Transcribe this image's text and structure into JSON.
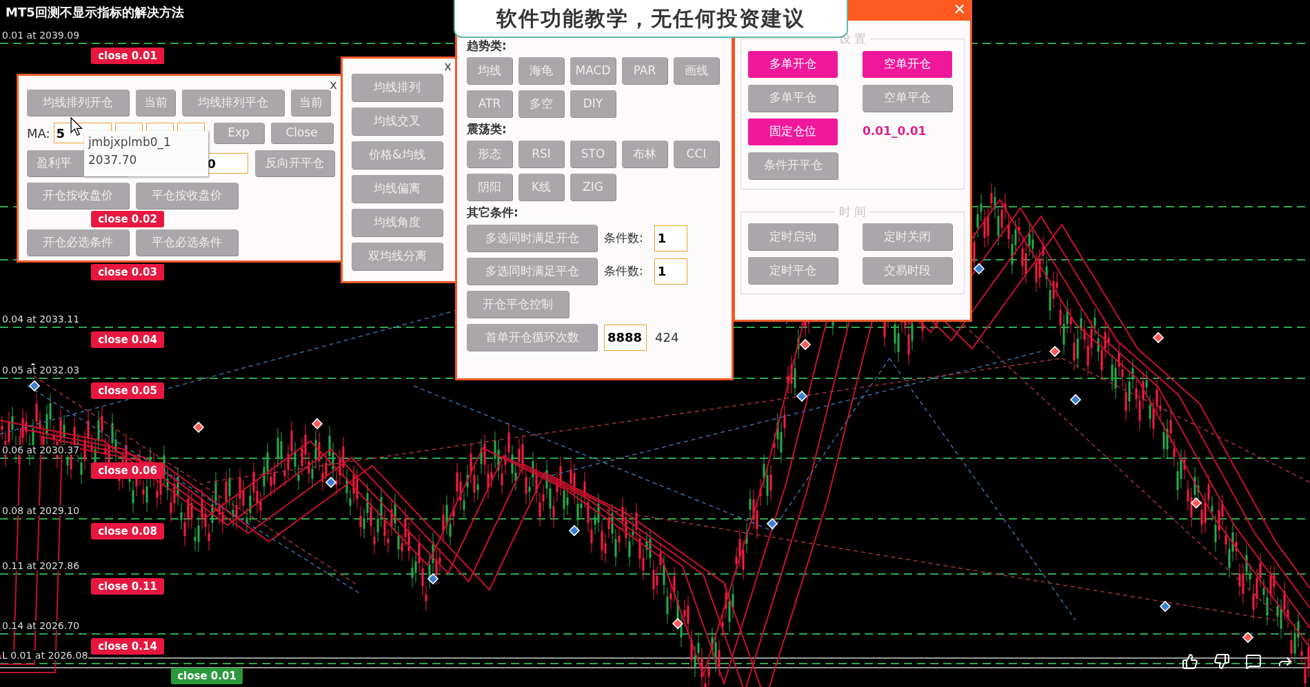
{
  "video_title": "MT5回测不显示指标的解决方法",
  "caption": "软件功能教学，无任何投资建议",
  "chart": {
    "levels": [
      {
        "kind": "buy",
        "label": "0.01 at 2039.09",
        "close": "close 0.01"
      },
      {
        "kind": "buy",
        "close": "close 0.02"
      },
      {
        "kind": "buy",
        "close": "close 0.03"
      },
      {
        "kind": "buy",
        "label": "0.04 at 2033.11",
        "close": "close 0.04"
      },
      {
        "kind": "buy",
        "label": "0.05 at 2032.03",
        "close": "close 0.05"
      },
      {
        "kind": "buy",
        "label": "0.06 at 2030.37",
        "close": "close 0.06"
      },
      {
        "kind": "buy",
        "label": "0.08 at 2029.10",
        "close": "close 0.08"
      },
      {
        "kind": "buy",
        "label": "0.11 at 2027.86",
        "close": "close 0.11"
      },
      {
        "kind": "buy",
        "label": "0.14 at 2026.70",
        "close": "close 0.14"
      },
      {
        "kind": "sell",
        "label": "L 0.01 at 2026.08",
        "close": "close 0.01"
      }
    ]
  },
  "ma_panel": {
    "close_icon": "x",
    "row1": [
      "均线排列开仓",
      "当前",
      "均线排列平仓",
      "当前"
    ],
    "ma_label": "MA:",
    "ma_input": "5",
    "exp_button": "Exp",
    "close_button": "Close",
    "profit_button": "盈利平",
    "profit_input": "0",
    "reverse_button": "反向开平仓",
    "row4": [
      "开仓按收盘价",
      "平仓按收盘价"
    ],
    "row5": [
      "开仓必选条件",
      "平仓必选条件"
    ]
  },
  "tooltip": {
    "name": "jmbjxplmb0_1",
    "value": "2037.70"
  },
  "ma_type_panel": {
    "close_icon": "x",
    "buttons": [
      "均线排列",
      "均线交叉",
      "价格&均线",
      "均线偏离",
      "均线角度",
      "双均线分离"
    ]
  },
  "condition_panel": {
    "sections": [
      {
        "title": "趋势类:",
        "rows": [
          [
            "均线",
            "海龟",
            "MACD",
            "PAR",
            "画线"
          ],
          [
            "ATR",
            "多空",
            "DIY"
          ]
        ]
      },
      {
        "title": "震荡类:",
        "rows": [
          [
            "形态",
            "RSI",
            "STO",
            "布林",
            "CCI"
          ],
          [
            "阴阳",
            "K线",
            "ZIG"
          ]
        ]
      }
    ],
    "other": {
      "title": "其它条件:",
      "rows": [
        {
          "kind": "count",
          "button": "多选同时满足开仓",
          "label": "条件数:",
          "value": "1"
        },
        {
          "kind": "count",
          "button": "多选同时满足平仓",
          "label": "条件数:",
          "value": "1"
        },
        {
          "kind": "button",
          "button": "开仓平仓控制"
        },
        {
          "kind": "loop",
          "button": "首单开仓循环次数",
          "value": "8888",
          "count": "424"
        }
      ]
    }
  },
  "trade_panel": {
    "close_icon": "✕",
    "groups": [
      {
        "legend": "设 置",
        "items": [
          {
            "kind": "button",
            "label": "多单开仓",
            "on": true
          },
          {
            "kind": "button",
            "label": "空单开仓",
            "on": true
          },
          {
            "kind": "button",
            "label": "多单平仓",
            "on": false
          },
          {
            "kind": "button",
            "label": "空单平仓",
            "on": false
          },
          {
            "kind": "button",
            "label": "固定仓位",
            "on": true
          },
          {
            "kind": "value",
            "label": "0.01_0.01"
          },
          {
            "kind": "button",
            "label": "条件开平仓",
            "on": false
          }
        ]
      },
      {
        "legend": "时 间",
        "items": [
          {
            "kind": "button",
            "label": "定时启动",
            "on": false
          },
          {
            "kind": "button",
            "label": "定时关闭",
            "on": false
          },
          {
            "kind": "button",
            "label": "定时平仓",
            "on": false
          },
          {
            "kind": "button",
            "label": "交易时段",
            "on": false
          }
        ]
      }
    ]
  }
}
